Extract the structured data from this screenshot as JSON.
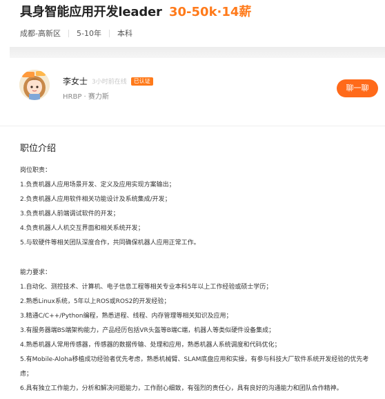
{
  "job": {
    "title": "具身智能应用开发leader",
    "salary": "30-50k·14薪",
    "location": "成都-高新区",
    "experience": "5-10年",
    "education": "本科"
  },
  "recruiter": {
    "name": "李女士",
    "active_status": "3小时前在线",
    "verified_badge": "已认证",
    "title": "HRBP · 赛力斯",
    "chat_button": "聊一聊"
  },
  "description": {
    "section_title": "职位介绍",
    "duties_heading": "岗位职责：",
    "duties": [
      "1.负责机器人应用场景开发、定义及应用实现方案输出；",
      "2.负责机器人应用软件相关功能设计及系统集成/开发；",
      "3.负责机器人前端调试软件的开发；",
      "4.负责机器人人机交互界面和相关系统开发；",
      "5.与软硬件等相关团队深度合作，共同确保机器人应用正常工作。"
    ],
    "requirements_heading": "能力要求：",
    "requirements": [
      "1.自动化、测控技术、计算机、电子信息工程等相关专业本科5年以上工作经验或硕士学历；",
      "2.熟悉Linux系统，5年以上ROS或ROS2的开发经验；",
      "3.精通C/C++/Python编程，熟悉进程、线程、内存管理等相关知识及应用；",
      "3.有服务器端BS端架构能力，产品经历包括VR头盔等B端C端，机器人等类似硬件设备集成；",
      "4.熟悉机器人常用传感器，传感器的数据传输、处理和应用，熟悉机器人系统调度和代码优化；",
      "5.有Mobile-Aloha移植成功经验者优先考虑，熟悉机械臂、SLAM底盘应用和实操，有参与科技大厂软件系统开发经验的优先考虑；",
      "6.具有独立工作能力，分析和解决问题能力，工作耐心细致，有强烈的责任心，具有良好的沟通能力和团队合作精神。"
    ]
  }
}
